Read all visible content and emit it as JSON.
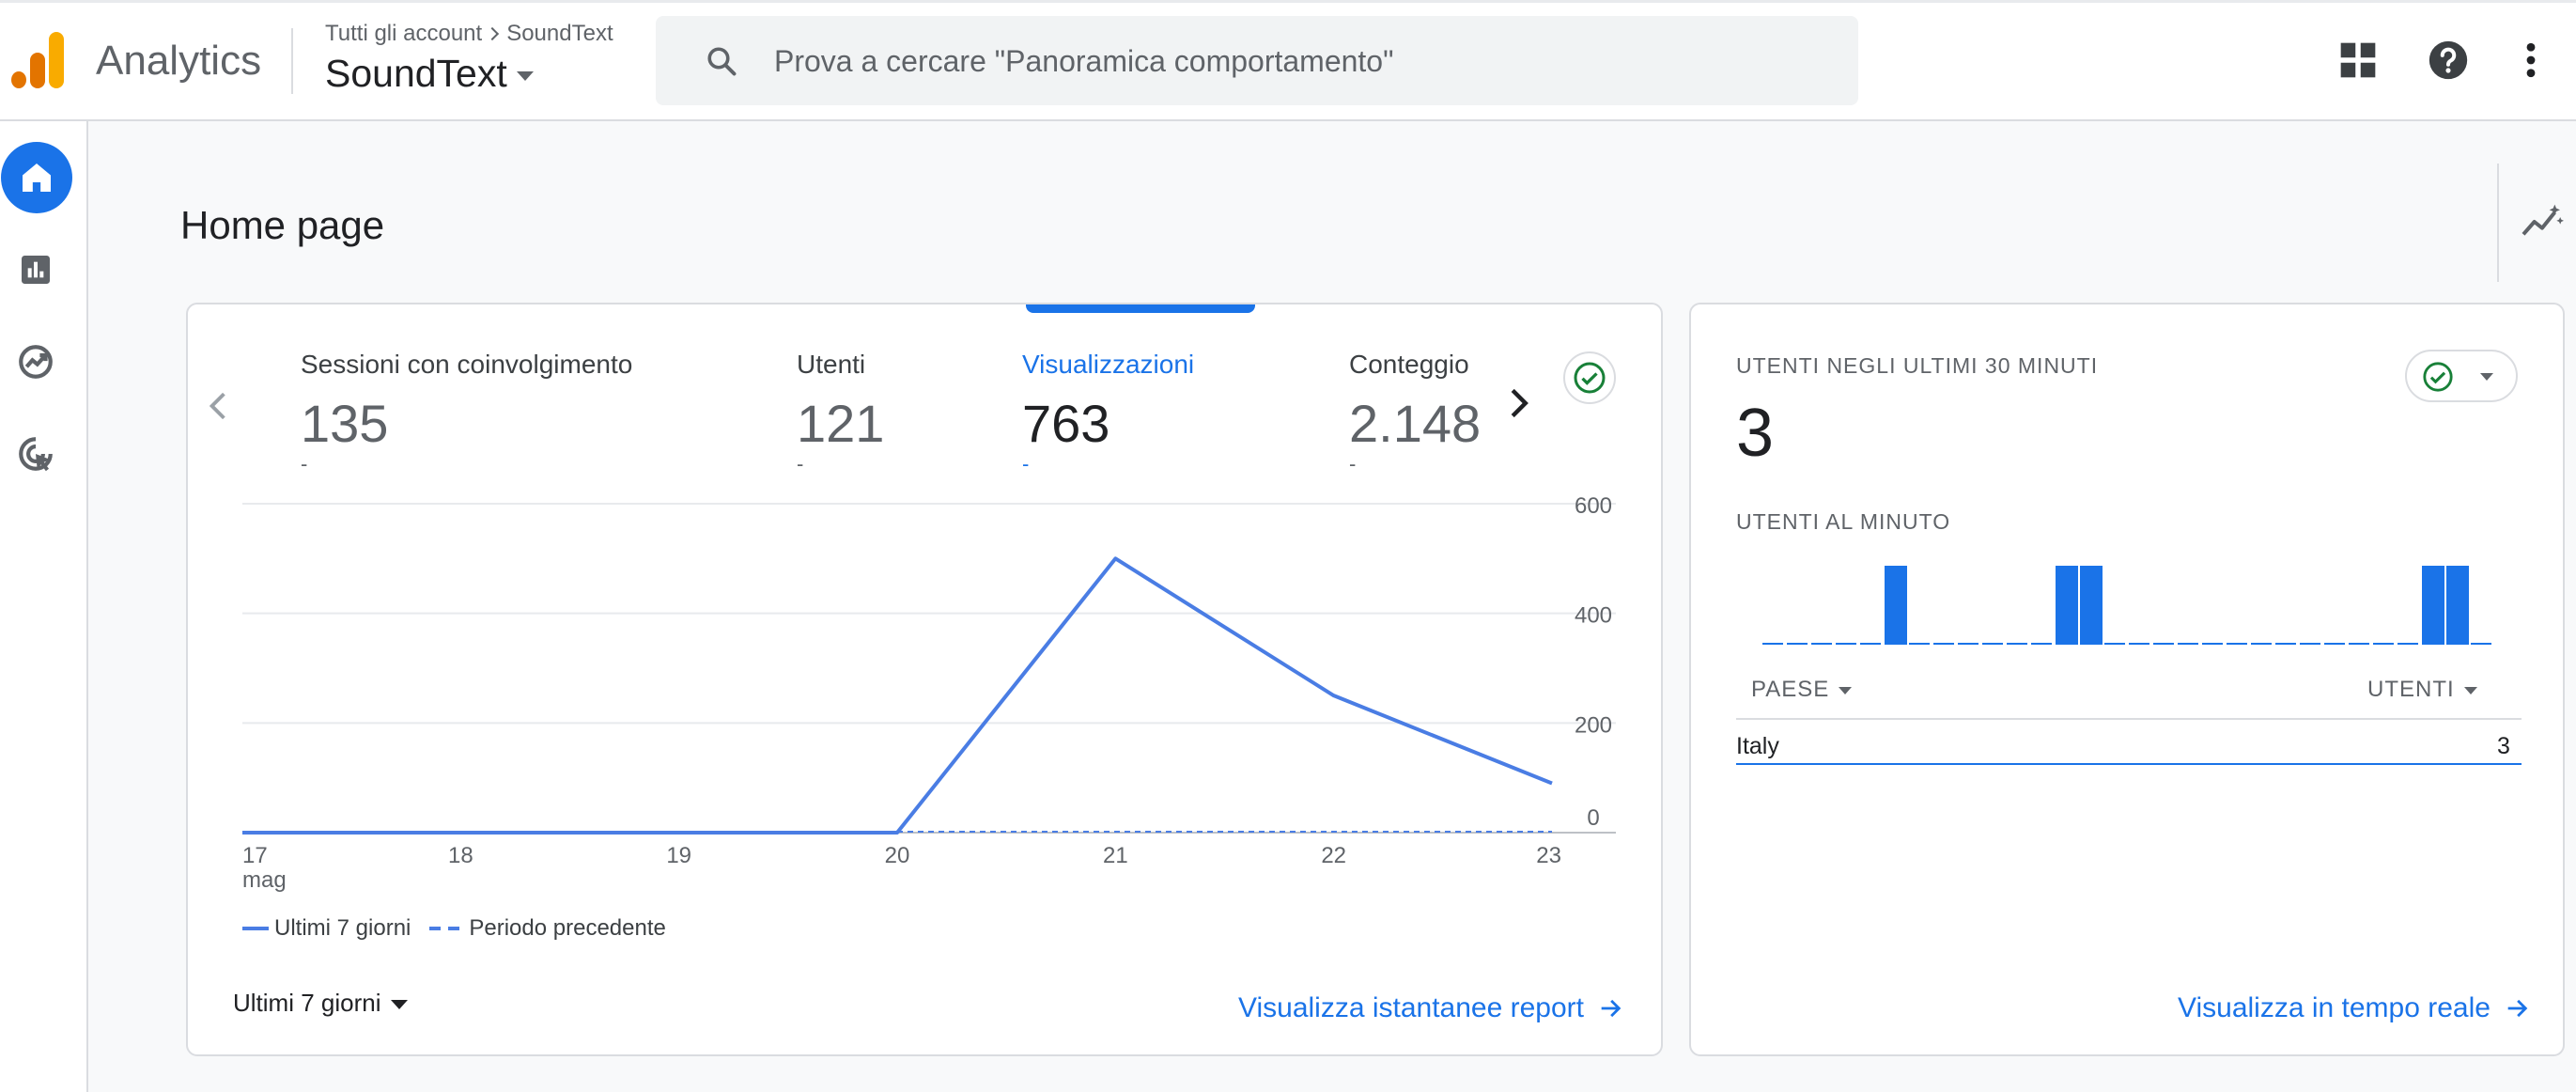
{
  "header": {
    "app_name": "Analytics",
    "breadcrumb": {
      "root": "Tutti gli account",
      "current": "SoundText"
    },
    "property_name": "SoundText",
    "search_placeholder": "Prova a cercare \"Panoramica comportamento\"",
    "logo_colors": [
      "#f9ab00",
      "#e37400",
      "#e37400"
    ]
  },
  "rail": {
    "items": [
      {
        "name": "home",
        "icon": "home-icon",
        "active": true
      },
      {
        "name": "reports",
        "icon": "bar-chart-icon",
        "active": false
      },
      {
        "name": "explore",
        "icon": "explore-icon",
        "active": false
      },
      {
        "name": "advertising",
        "icon": "advertising-icon",
        "active": false
      }
    ]
  },
  "main": {
    "page_title": "Home page"
  },
  "overview_card": {
    "metrics": [
      {
        "label": "Sessioni con coinvolgimento",
        "value": "135",
        "delta": "-",
        "active": false
      },
      {
        "label": "Utenti",
        "value": "121",
        "delta": "-",
        "active": false
      },
      {
        "label": "Visualizzazioni",
        "value": "763",
        "delta": "-",
        "active": true
      },
      {
        "label": "Conteggio",
        "value": "2.148",
        "delta": "-",
        "active": false
      }
    ],
    "date_range": "Ultimi 7 giorni",
    "link": "Visualizza istantanee report",
    "legend": {
      "current": "Ultimi 7 giorni",
      "previous": "Periodo precedente"
    },
    "chart_data": {
      "type": "line",
      "x": [
        "17 mag",
        "18",
        "19",
        "20",
        "21",
        "22",
        "23"
      ],
      "x_tick_labels": [
        {
          "day": "17",
          "month": "mag"
        },
        {
          "day": "18",
          "month": ""
        },
        {
          "day": "19",
          "month": ""
        },
        {
          "day": "20",
          "month": ""
        },
        {
          "day": "21",
          "month": ""
        },
        {
          "day": "22",
          "month": ""
        },
        {
          "day": "23",
          "month": ""
        }
      ],
      "series": [
        {
          "name": "Ultimi 7 giorni",
          "values": [
            0,
            0,
            0,
            0,
            500,
            250,
            90
          ],
          "style": "solid"
        },
        {
          "name": "Periodo precedente",
          "values": [
            0,
            0,
            0,
            0,
            0,
            0,
            0
          ],
          "style": "dashed"
        }
      ],
      "y_ticks": [
        0,
        200,
        400,
        600
      ],
      "ylim": [
        0,
        600
      ],
      "y_axis_side": "right",
      "grid": true,
      "legend_position": "bottom-left",
      "color": "#4a7de4"
    }
  },
  "realtime_card": {
    "title": "UTENTI NEGLI ULTIMI 30 MINUTI",
    "value": "3",
    "subtitle": "UTENTI AL MINUTO",
    "per_minute_chart": {
      "type": "bar",
      "values": [
        0,
        0,
        0,
        0,
        0,
        1,
        0,
        0,
        0,
        0,
        0,
        0,
        1,
        1,
        0,
        0,
        0,
        0,
        0,
        0,
        0,
        0,
        0,
        0,
        0,
        0,
        0,
        1,
        1,
        0
      ],
      "color": "#1a73e8"
    },
    "table": {
      "columns": [
        "PAESE",
        "UTENTI"
      ],
      "rows": [
        {
          "country": "Italy",
          "users": "3"
        }
      ]
    },
    "link": "Visualizza in tempo reale"
  }
}
